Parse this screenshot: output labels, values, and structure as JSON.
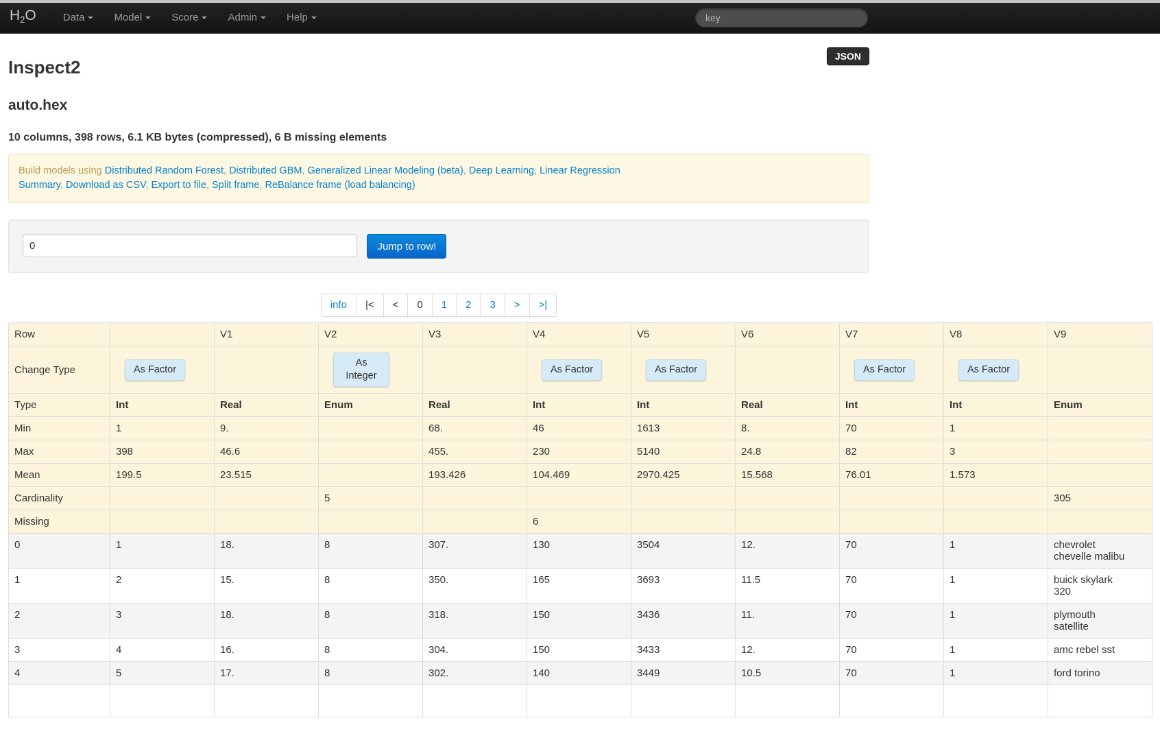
{
  "colors": {
    "link_blue": "#0980cd",
    "alert_text": "#c09853",
    "alert_bg": "#fcf8e3",
    "table_cream": "#fcf5dc",
    "primary_button_blue": "#0765cb",
    "change_button_bg": "#d7eaf7",
    "navbar_bg": "#1b1b1b"
  },
  "navbar": {
    "brand_parts": [
      "H",
      "2",
      "O"
    ],
    "menus": [
      {
        "label": "Data"
      },
      {
        "label": "Model"
      },
      {
        "label": "Score"
      },
      {
        "label": "Admin"
      },
      {
        "label": "Help"
      }
    ],
    "search_placeholder": "key"
  },
  "page": {
    "title": "Inspect2",
    "json_button_label": "JSON",
    "frame_name": "auto.hex",
    "summary": "10 columns, 398 rows, 6.1 KB bytes (compressed), 6 B missing elements"
  },
  "build_panel": {
    "prefix": "Build models using ",
    "separator": ", ",
    "model_links": [
      "Distributed Random Forest",
      "Distributed GBM",
      "Generalized Linear Modeling (beta)",
      "Deep Learning",
      "Linear Regression"
    ],
    "action_links": [
      "Summary",
      "Download as CSV",
      "Export to file",
      "Split frame",
      "ReBalance frame (load balancing)"
    ]
  },
  "jump": {
    "input_value": "0",
    "button_label": "Jump to row!"
  },
  "pagination": {
    "items": [
      {
        "label": "info",
        "name": "info",
        "style": "link"
      },
      {
        "label": "|<",
        "name": "first",
        "style": "plain"
      },
      {
        "label": "<",
        "name": "prev",
        "style": "plain"
      },
      {
        "label": "0",
        "name": "page-0",
        "style": "plain"
      },
      {
        "label": "1",
        "name": "page-1",
        "style": "link"
      },
      {
        "label": "2",
        "name": "page-2",
        "style": "link"
      },
      {
        "label": "3",
        "name": "page-3",
        "style": "link"
      },
      {
        "label": ">",
        "name": "next",
        "style": "link"
      },
      {
        "label": ">|",
        "name": "last",
        "style": "link"
      }
    ]
  },
  "table": {
    "headers": [
      "Row",
      "",
      "V1",
      "V2",
      "V3",
      "V4",
      "V5",
      "V6",
      "V7",
      "V8",
      "V9"
    ],
    "change_type": {
      "label": "Change Type",
      "buttons": [
        "As Factor",
        "",
        "As Integer",
        "",
        "As Factor",
        "As Factor",
        "",
        "As Factor",
        "As Factor",
        ""
      ]
    },
    "stat_rows": [
      {
        "label": "Type",
        "bold": true,
        "values": [
          "Int",
          "Real",
          "Enum",
          "Real",
          "Int",
          "Int",
          "Real",
          "Int",
          "Int",
          "Enum"
        ]
      },
      {
        "label": "Min",
        "values": [
          "1",
          "9.",
          "",
          "68.",
          "46",
          "1613",
          "8.",
          "70",
          "1",
          ""
        ]
      },
      {
        "label": "Max",
        "values": [
          "398",
          "46.6",
          "",
          "455.",
          "230",
          "5140",
          "24.8",
          "82",
          "3",
          ""
        ]
      },
      {
        "label": "Mean",
        "values": [
          "199.5",
          "23.515",
          "",
          "193.426",
          "104.469",
          "2970.425",
          "15.568",
          "76.01",
          "1.573",
          ""
        ]
      },
      {
        "label": "Cardinality",
        "values": [
          "",
          "",
          "5",
          "",
          "",
          "",
          "",
          "",
          "",
          "305"
        ]
      },
      {
        "label": "Missing",
        "values": [
          "",
          "",
          "",
          "",
          "6",
          "",
          "",
          "",
          "",
          ""
        ]
      }
    ],
    "data_rows": [
      {
        "label": "0",
        "values": [
          "1",
          "18.",
          "8",
          "307.",
          "130",
          "3504",
          "12.",
          "70",
          "1",
          "chevrolet chevelle malibu"
        ]
      },
      {
        "label": "1",
        "values": [
          "2",
          "15.",
          "8",
          "350.",
          "165",
          "3693",
          "11.5",
          "70",
          "1",
          "buick skylark 320"
        ]
      },
      {
        "label": "2",
        "values": [
          "3",
          "18.",
          "8",
          "318.",
          "150",
          "3436",
          "11.",
          "70",
          "1",
          "plymouth satellite"
        ]
      },
      {
        "label": "3",
        "values": [
          "4",
          "16.",
          "8",
          "304.",
          "150",
          "3433",
          "12.",
          "70",
          "1",
          "amc rebel sst"
        ]
      },
      {
        "label": "4",
        "values": [
          "5",
          "17.",
          "8",
          "302.",
          "140",
          "3449",
          "10.5",
          "70",
          "1",
          "ford torino"
        ]
      }
    ]
  }
}
